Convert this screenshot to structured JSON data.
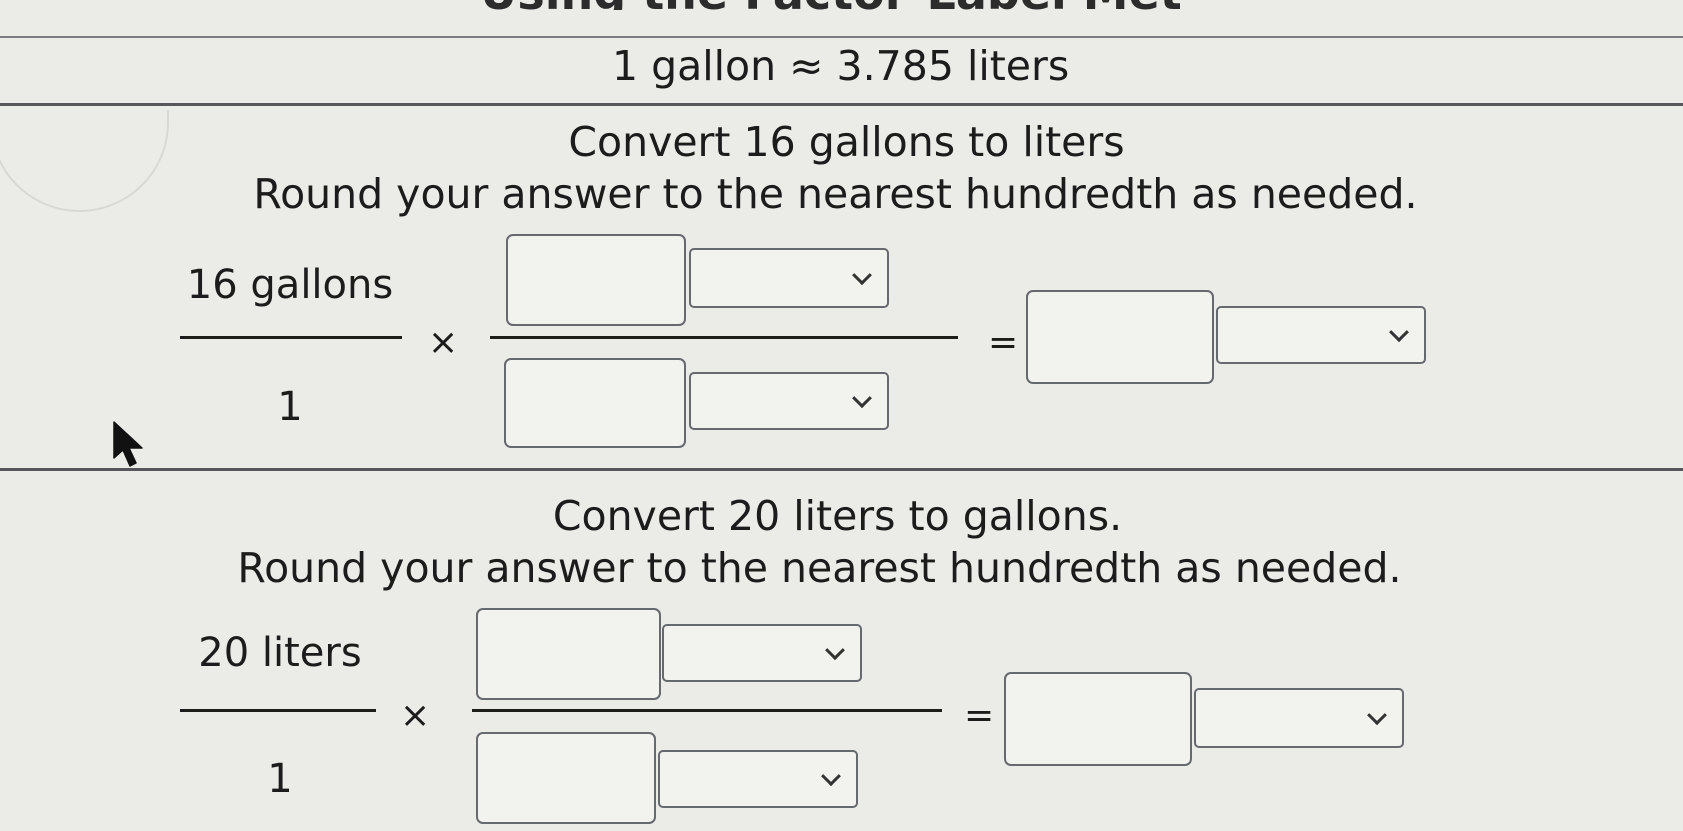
{
  "header": {
    "cut_title": "Using the Factor-Label Method"
  },
  "reference": {
    "text": "1 gallon ≈ 3.785 liters"
  },
  "problem1": {
    "prompt": "Convert 16 gallons to liters",
    "instruction": "Round your answer to the nearest hundredth as needed.",
    "given_numerator": "16 gallons",
    "given_denominator": "1",
    "times_symbol": "×",
    "equals_symbol": "=",
    "factor_numerator": {
      "value": "",
      "unit": ""
    },
    "factor_denominator": {
      "value": "",
      "unit": ""
    },
    "answer": {
      "value": "",
      "unit": ""
    }
  },
  "problem2": {
    "prompt": "Convert 20 liters to gallons.",
    "instruction": "Round your answer to the nearest hundredth as needed.",
    "given_numerator": "20 liters",
    "given_denominator": "1",
    "times_symbol": "×",
    "equals_symbol": "=",
    "factor_numerator": {
      "value": "",
      "unit": ""
    },
    "factor_denominator": {
      "value": "",
      "unit": ""
    },
    "answer": {
      "value": "",
      "unit": ""
    }
  },
  "icons": {
    "cursor": "mouse-pointer-icon",
    "dropdown": "chevron-down-icon"
  }
}
